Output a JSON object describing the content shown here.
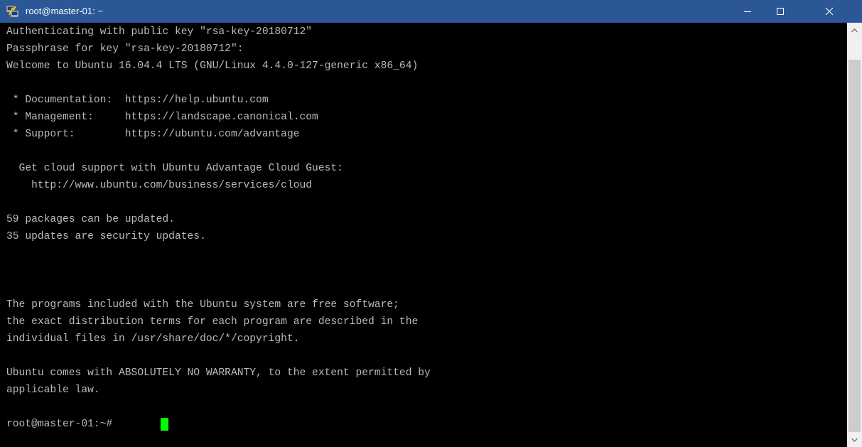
{
  "window": {
    "title": "root@master-01: ~",
    "icon": "putty-icon",
    "controls": {
      "minimize": "minimize-icon",
      "maximize": "maximize-icon",
      "close": "close-icon"
    }
  },
  "terminal": {
    "lines": [
      "Authenticating with public key \"rsa-key-20180712\"",
      "Passphrase for key \"rsa-key-20180712\":",
      "Welcome to Ubuntu 16.04.4 LTS (GNU/Linux 4.4.0-127-generic x86_64)",
      "",
      " * Documentation:  https://help.ubuntu.com",
      " * Management:     https://landscape.canonical.com",
      " * Support:        https://ubuntu.com/advantage",
      "",
      "  Get cloud support with Ubuntu Advantage Cloud Guest:",
      "    http://www.ubuntu.com/business/services/cloud",
      "",
      "59 packages can be updated.",
      "35 updates are security updates.",
      "",
      "",
      "",
      "The programs included with the Ubuntu system are free software;",
      "the exact distribution terms for each program are described in the",
      "individual files in /usr/share/doc/*/copyright.",
      "",
      "Ubuntu comes with ABSOLUTELY NO WARRANTY, to the extent permitted by",
      "applicable law.",
      "",
      "root@master-01:~# "
    ]
  },
  "colors": {
    "titlebar": "#2b5797",
    "terminal_bg": "#000000",
    "terminal_fg": "#bbbbbb",
    "cursor": "#00ff00"
  }
}
